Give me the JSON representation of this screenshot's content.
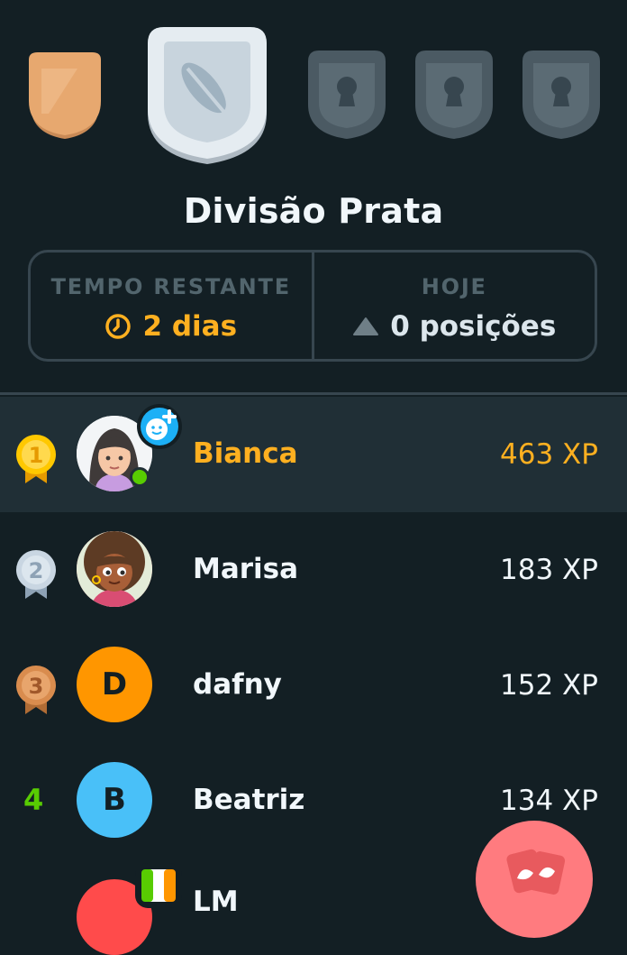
{
  "league": {
    "title": "Divisão Prata",
    "badges": [
      "bronze-league-badge",
      "silver-league-badge",
      "locked-league-badge",
      "locked-league-badge",
      "locked-league-badge"
    ]
  },
  "stats": {
    "time_label": "TEMPO RESTANTE",
    "time_value": "2 dias",
    "today_label": "HOJE",
    "today_value": "0 posições"
  },
  "leaderboard": [
    {
      "rank": "1",
      "name": "Bianca",
      "xp": "463 XP",
      "avatar": "avatar-illustration",
      "highlight": true
    },
    {
      "rank": "2",
      "name": "Marisa",
      "xp": "183 XP",
      "avatar": "avatar-illustration"
    },
    {
      "rank": "3",
      "name": "dafny",
      "xp": "152 XP",
      "avatar_letter": "D",
      "avatar_color": "#ff9600"
    },
    {
      "rank": "4",
      "name": "Beatriz",
      "xp": "134 XP",
      "avatar_letter": "B",
      "avatar_color": "#49c0f8"
    },
    {
      "name": "LM"
    }
  ],
  "colors": {
    "background": "#131f24",
    "highlight_row": "#202f36",
    "gold": "#ffb020",
    "green": "#58cc02",
    "border": "#37464f"
  }
}
